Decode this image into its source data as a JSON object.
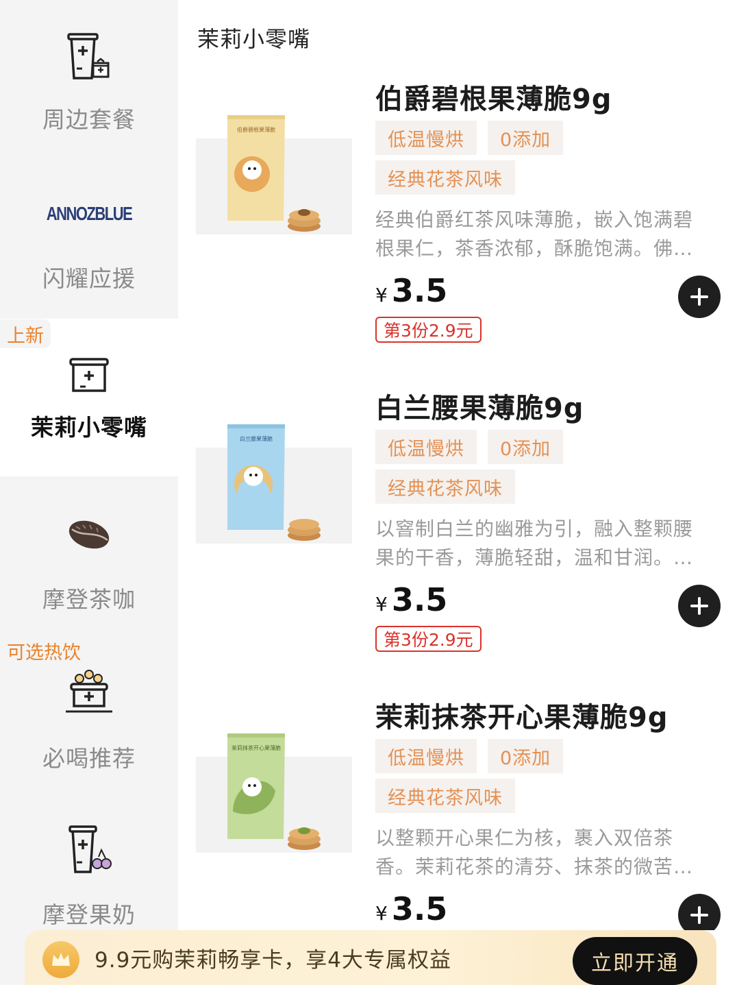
{
  "sidebar": {
    "categories": [
      {
        "label": "周边套餐",
        "icon": "cup-gift-icon"
      },
      {
        "label": "闪耀应援",
        "icon": "brand-logo",
        "logo_text": "ANNOZBLUE"
      },
      {
        "label": "茉莉小零嘴",
        "icon": "snack-bowl-icon",
        "tag": "上新",
        "active": true
      },
      {
        "label": "摩登茶咖",
        "icon": "coffee-bean-icon"
      },
      {
        "label": "必喝推荐",
        "icon": "flower-cup-icon",
        "tag": "可选热饮"
      },
      {
        "label": "摩登果奶",
        "icon": "cup-cherry-icon"
      }
    ]
  },
  "section": {
    "title": "茉莉小零嘴"
  },
  "products": [
    {
      "name": "伯爵碧根果薄脆9g",
      "tags": [
        "低温慢烘",
        "0添加",
        "经典花茶风味"
      ],
      "desc_line1": "经典伯爵红茶风味薄脆，嵌入饱满碧",
      "desc_line2": "根果仁，茶香浓郁，酥脆饱满。佛…",
      "currency": "¥",
      "price": "3.5",
      "promo": "第3份2.9元",
      "package_label": "伯爵碧根果薄脆",
      "package_color": "#f3dfa3"
    },
    {
      "name": "白兰腰果薄脆9g",
      "tags": [
        "低温慢烘",
        "0添加",
        "经典花茶风味"
      ],
      "desc_line1": "以窨制白兰的幽雅为引，融入整颗腰",
      "desc_line2": "果的干香，薄脆轻甜，温和甘润。…",
      "currency": "¥",
      "price": "3.5",
      "promo": "第3份2.9元",
      "package_label": "白兰腰果薄脆",
      "package_color": "#a9d6ef"
    },
    {
      "name": "茉莉抹茶开心果薄脆9g",
      "tags": [
        "低温慢烘",
        "0添加",
        "经典花茶风味"
      ],
      "desc_line1": "以整颗开心果仁为核，裹入双倍茶",
      "desc_line2": "香。茉莉花茶的清芬、抹茶的微苦…",
      "currency": "¥",
      "price": "3.5",
      "package_label": "茉莉抹茶开心果薄脆",
      "package_color": "#c4dc9a"
    }
  ],
  "membership_bar": {
    "text": "9.9元购茉莉畅享卡，享4大专属权益",
    "button": "立即开通"
  },
  "colors": {
    "tag_text": "#e39154",
    "tag_bg": "#f5f1ee",
    "promo": "#d9322b",
    "sidebar_bg": "#f4f4f4",
    "button_dark": "#1f1f1f"
  }
}
